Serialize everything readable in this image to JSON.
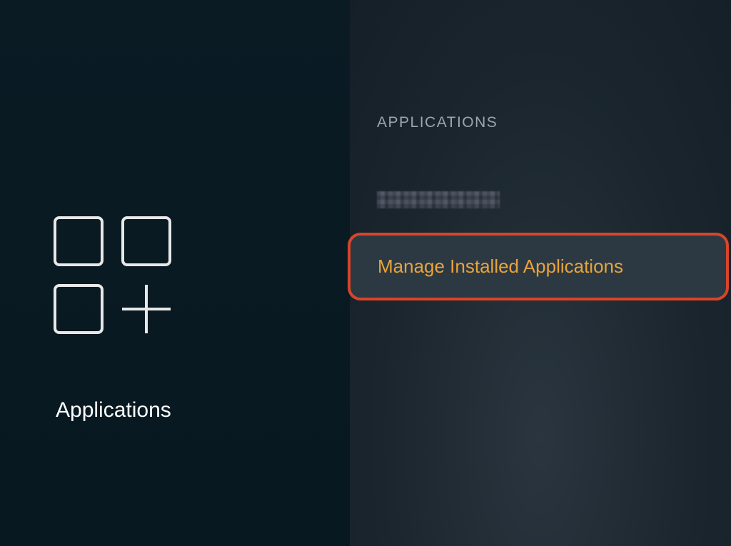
{
  "left": {
    "title": "Applications"
  },
  "right": {
    "header": "APPLICATIONS",
    "items": [
      {
        "label": "",
        "obscured": true
      },
      {
        "label": "Manage Installed Applications",
        "selected": true
      }
    ]
  }
}
